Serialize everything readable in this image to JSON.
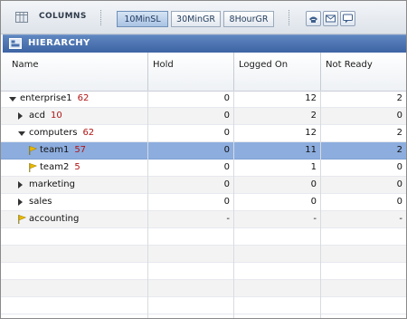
{
  "toolbar": {
    "columns_label": "COLUMNS",
    "segments": [
      "10MinSL",
      "30MinGR",
      "8HourGR"
    ],
    "active_segment": "10MinSL",
    "action_icons": [
      "phone-icon",
      "mail-icon",
      "chat-icon"
    ]
  },
  "panel": {
    "title": "HIERARCHY",
    "icon": "hierarchy-icon"
  },
  "table": {
    "columns": [
      "Name",
      "Hold",
      "Logged On",
      "Not Ready"
    ],
    "rows": [
      {
        "name": "enterprise1",
        "count": "62",
        "hold": "0",
        "logged_on": "12",
        "not_ready": "2",
        "expander": "down",
        "level": 0
      },
      {
        "name": "acd",
        "count": "10",
        "hold": "0",
        "logged_on": "2",
        "not_ready": "0",
        "expander": "right",
        "level": 1
      },
      {
        "name": "computers",
        "count": "62",
        "hold": "0",
        "logged_on": "12",
        "not_ready": "2",
        "expander": "down",
        "level": 1
      },
      {
        "name": "team1",
        "count": "57",
        "hold": "0",
        "logged_on": "11",
        "not_ready": "2",
        "expander": "flag",
        "level": 2,
        "selected": true
      },
      {
        "name": "team2",
        "count": "5",
        "hold": "0",
        "logged_on": "1",
        "not_ready": "0",
        "expander": "flag",
        "level": 2
      },
      {
        "name": "marketing",
        "count": "",
        "hold": "0",
        "logged_on": "0",
        "not_ready": "0",
        "expander": "right",
        "level": 1
      },
      {
        "name": "sales",
        "count": "",
        "hold": "0",
        "logged_on": "0",
        "not_ready": "0",
        "expander": "right",
        "level": 1
      },
      {
        "name": "accounting",
        "count": "",
        "hold": "-",
        "logged_on": "-",
        "not_ready": "-",
        "expander": "flag",
        "level": 1
      }
    ]
  },
  "colors": {
    "selected_row": "#8dadde",
    "count_text": "#b01515",
    "header_bar": "#4a70ad",
    "flag": "#e8b800"
  }
}
